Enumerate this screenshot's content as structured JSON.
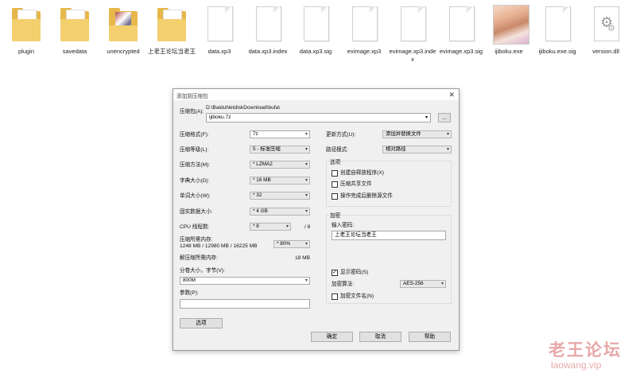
{
  "files": [
    {
      "name": "plugin",
      "type": "folder"
    },
    {
      "name": "savedata",
      "type": "folder"
    },
    {
      "name": "unencrypted",
      "type": "folder-image"
    },
    {
      "name": "上老王论坛当老王",
      "type": "folder"
    },
    {
      "name": "data.xp3",
      "type": "file"
    },
    {
      "name": "data.xp3.index",
      "type": "file"
    },
    {
      "name": "data.xp3.sig",
      "type": "file"
    },
    {
      "name": "evimage.xp3",
      "type": "file"
    },
    {
      "name": "evimage.xp3.index",
      "type": "file"
    },
    {
      "name": "evimage.xp3.sig",
      "type": "file"
    },
    {
      "name": "ijiboku.exe",
      "type": "exe"
    },
    {
      "name": "ijiboku.exe.sig",
      "type": "file"
    },
    {
      "name": "version.dll",
      "type": "dll"
    }
  ],
  "dialog": {
    "title": "添加到压缩包",
    "close": "✕",
    "archive_label": "压缩包(A):",
    "archive_path": "D:\\BaiduNetdiskDownload\\bufa\\",
    "archive_name": "ijiboku.7z",
    "browse": "...",
    "left": {
      "format_label": "压缩格式(F):",
      "format_value": "7z",
      "level_label": "压缩等级(L):",
      "level_value": "5 - 标准压缩",
      "method_label": "压缩方法(M):",
      "method_value": "* LZMA2",
      "dict_label": "字典大小(D):",
      "dict_value": "* 16 MB",
      "word_label": "单词大小(W):",
      "word_value": "* 32",
      "solid_label": "固实数据大小:",
      "solid_value": "* 4 GB",
      "threads_label": "CPU 线程数:",
      "threads_value": "* 8",
      "threads_max": "/ 8",
      "mem_label": "压缩所需内存:",
      "mem_detail": "1248 MB / 12980 MB / 16225 MB",
      "mem_value": "* 80%",
      "decomp_label": "解压缩所需内存:",
      "decomp_value": "18 MB",
      "split_label": "分卷大小，字节(V):",
      "split_value": "800M",
      "params_label": "参数(P):",
      "params_value": "",
      "options_button": "选项"
    },
    "right": {
      "update_label": "更新方式(U):",
      "update_value": "添加并替换文件",
      "path_label": "路径模式:",
      "path_value": "相对路径",
      "options_title": "选项",
      "opt_sfx": "创建自释放程序(X)",
      "opt_shared": "压缩共享文件",
      "opt_delete": "操作完成后删除源文件",
      "enc_title": "加密",
      "enc_pw_label": "输入密码:",
      "enc_pw_value": "上老王论坛当老王",
      "show_pw": "显示密码(S)",
      "show_pw_checked": "✓",
      "enc_method_label": "加密算法:",
      "enc_method_value": "AES-256",
      "enc_names": "加密文件名(N)"
    },
    "buttons": {
      "ok": "确定",
      "cancel": "取消",
      "help": "帮助"
    }
  },
  "watermark": {
    "title": "老王论坛",
    "url": "laowang.vip"
  }
}
